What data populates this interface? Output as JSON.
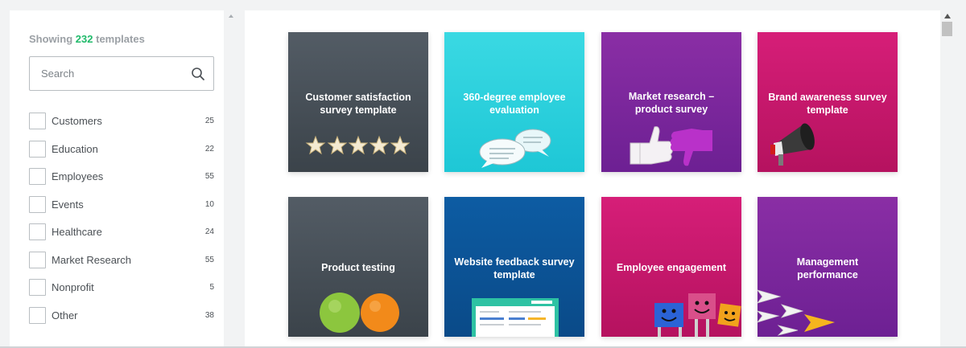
{
  "header": {
    "showing_prefix": "Showing",
    "count": "232",
    "showing_suffix": "templates"
  },
  "search": {
    "placeholder": "Search"
  },
  "filters": [
    {
      "label": "Customers",
      "count": "25"
    },
    {
      "label": "Education",
      "count": "22"
    },
    {
      "label": "Employees",
      "count": "55"
    },
    {
      "label": "Events",
      "count": "10"
    },
    {
      "label": "Healthcare",
      "count": "24"
    },
    {
      "label": "Market Research",
      "count": "55"
    },
    {
      "label": "Nonprofit",
      "count": "5"
    },
    {
      "label": "Other",
      "count": "38"
    }
  ],
  "templates": [
    {
      "title": "Customer satisfaction survey template",
      "icon": "stars-icon"
    },
    {
      "title": "360-degree employee evaluation",
      "icon": "speech-bubbles-icon"
    },
    {
      "title": "Market research – product survey",
      "icon": "thumbs-icon"
    },
    {
      "title": "Brand awareness survey template",
      "icon": "megaphone-icon"
    },
    {
      "title": "Product testing",
      "icon": "fruit-icon"
    },
    {
      "title": "Website feedback survey template",
      "icon": "browser-icon"
    },
    {
      "title": "Employee engagement",
      "icon": "happy-faces-icon"
    },
    {
      "title": "Management performance",
      "icon": "paper-planes-icon"
    }
  ],
  "colors": {
    "accent_green": "#1fba6a",
    "card_dark": "#4a535b",
    "card_cyan": "#2dd0dd",
    "card_purple": "#7b279c",
    "card_magenta": "#c9176c",
    "card_blue": "#0b53957"
  }
}
